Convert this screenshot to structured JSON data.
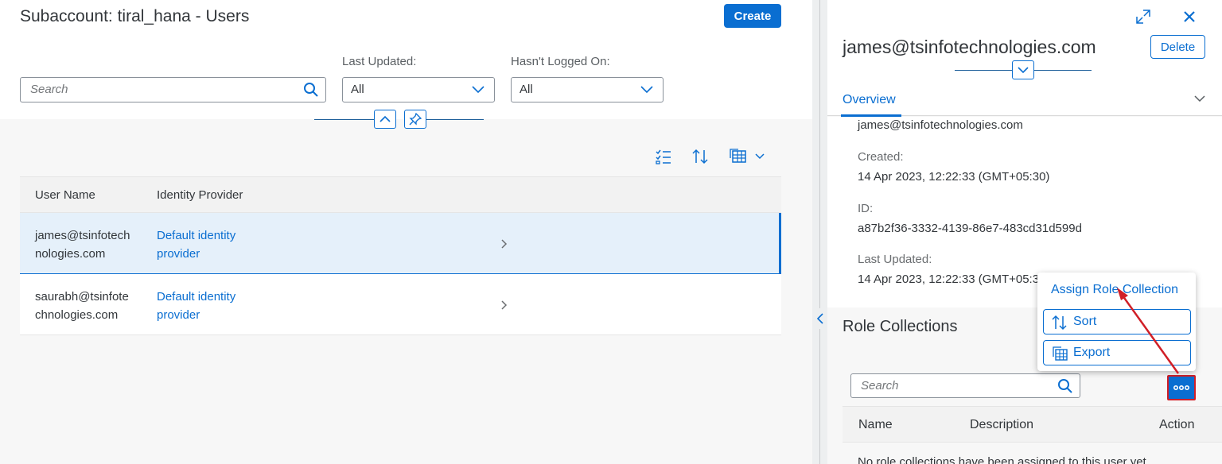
{
  "left_header": {
    "title": "Subaccount: tiral_hana - Users",
    "create_label": "Create",
    "search_placeholder": "Search",
    "last_updated_label": "Last Updated:",
    "last_updated_value": "All",
    "hasnt_logged_label": "Hasn't Logged On:",
    "hasnt_logged_value": "All"
  },
  "users_table": {
    "columns": [
      "User Name",
      "Identity Provider"
    ],
    "rows": [
      {
        "user_line1": "james@tsinfotech",
        "user_line2": "nologies.com",
        "idp_line1": "Default identity",
        "idp_line2": "provider",
        "selected": true
      },
      {
        "user_line1": "saurabh@tsinfote",
        "user_line2": "chnologies.com",
        "idp_line1": "Default identity",
        "idp_line2": "provider",
        "selected": false
      }
    ]
  },
  "detail": {
    "title": "james@tsinfotechnologies.com",
    "delete_label": "Delete",
    "tab_overview": "Overview",
    "email": "james@tsinfotechnologies.com",
    "created_label": "Created:",
    "created_value": "14 Apr 2023, 12:22:33 (GMT+05:30)",
    "id_label": "ID:",
    "id_value": "a87b2f36-3332-4139-86e7-483cd31d599d",
    "last_updated_label": "Last Updated:",
    "last_updated_value": "14 Apr 2023, 12:22:33 (GMT+05:30)"
  },
  "role_collections": {
    "title": "Role Collections",
    "search_placeholder": "Search",
    "columns": [
      "Name",
      "Description",
      "Action"
    ],
    "empty_text": "No role collections have been assigned to this user yet."
  },
  "popover": {
    "assign_label": "Assign Role Collection",
    "sort_label": "Sort",
    "export_label": "Export"
  },
  "colors": {
    "accent": "#0a6ed1",
    "highlight": "#d11f27"
  }
}
